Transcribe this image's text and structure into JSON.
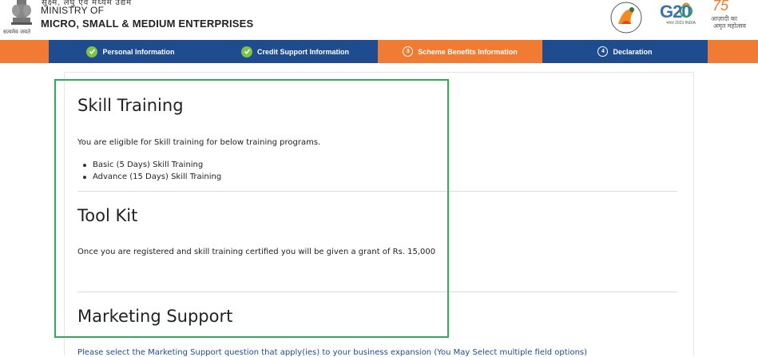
{
  "header": {
    "hindi_top": "सूक्ष्म, लघु एवं मध्यम उद्यम",
    "emblem_caption": "सत्यमेव जयते",
    "ministry_of": "MINISTRY OF",
    "ministry_name": "MICRO, SMALL & MEDIUM ENTERPRISES",
    "g20": "G20",
    "azadi_75": "75",
    "azadi_line1": "आज़ादी का",
    "azadi_line2": "अमृत महोत्सव"
  },
  "steps": [
    {
      "label": "Personal Information",
      "state": "done"
    },
    {
      "label": "Credit Support Information",
      "state": "done"
    },
    {
      "label": "Scheme Benefits Information",
      "state": "active",
      "number": "3"
    },
    {
      "label": "Declaration",
      "state": "pending",
      "number": "4"
    }
  ],
  "content": {
    "skill_title": "Skill Training",
    "skill_desc": "You are eligible for Skill training for below training programs.",
    "skill_items": [
      "Basic (5 Days) Skill Training",
      "Advance (15 Days) Skill Training"
    ],
    "toolkit_title": "Tool Kit",
    "toolkit_desc": "Once you are registered and skill training certified you will be given a grant of Rs. 15,000",
    "marketing_title": "Marketing Support",
    "marketing_desc": "Please select the Marketing Support question that apply(ies) to your business expansion (You May Select multiple field options)"
  },
  "colors": {
    "orange": "#f07b33",
    "navy": "#1e4c8e",
    "check_green": "#7ec24a",
    "highlight_green": "#2eae56"
  }
}
